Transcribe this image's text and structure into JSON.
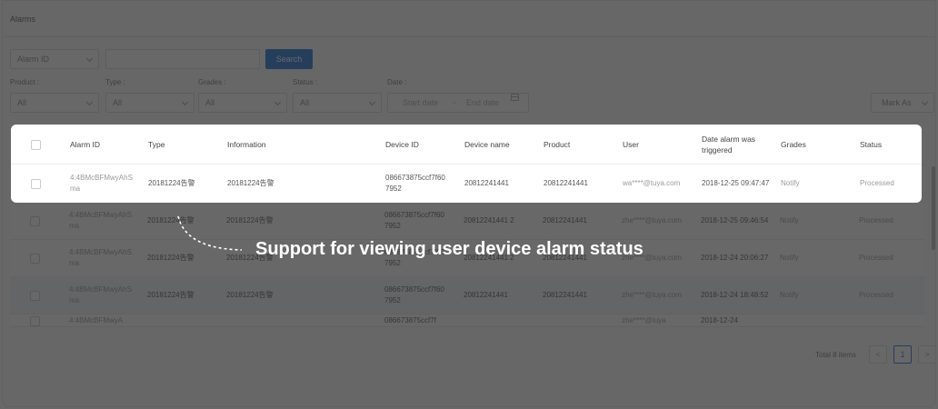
{
  "window_title": "Alarms",
  "filters": {
    "alarm_id_select": "Alarm ID",
    "search_button": "Search",
    "product_label": "Product :",
    "type_label": "Type :",
    "grades_label": "Grades :",
    "status_label": "Status :",
    "date_label": "Date :",
    "product_value": "All",
    "type_value": "All",
    "grades_value": "All",
    "status_value": "All",
    "start_date_placeholder": "Start date",
    "range_separator": "~",
    "end_date_placeholder": "End date",
    "mark_as": "Mark As"
  },
  "columns": [
    "Alarm ID",
    "Type",
    "Information",
    "Device ID",
    "Device name",
    "Product",
    "User",
    "Date alarm was triggered",
    "Grades",
    "Status"
  ],
  "rows": [
    {
      "alarm_id": "4:4BMcBFMwyAhSma",
      "type": "20181224告警",
      "information": "20181224告警",
      "device_id": "086673875ccf7f607952",
      "device_name": "20812241441",
      "product": "20812241441",
      "user": "wa****@tuya.com",
      "date": "2018-12-25 09:47:47",
      "grades": "Notify",
      "status": "Processed"
    },
    {
      "alarm_id": "4:4BMcBFMwyAhSma",
      "type": "20181224告警",
      "information": "20181224告警",
      "device_id": "086673875ccf7f607952",
      "device_name": "20812241441 2",
      "product": "20812241441",
      "user": "zhe****@tuya.com",
      "date": "2018-12-25 09:46:54",
      "grades": "Notify",
      "status": "Processed"
    },
    {
      "alarm_id": "4:4BMcBFMwyAhSma",
      "type": "20181224告警",
      "information": "20181224告警",
      "device_id": "086673875ccf7f607952",
      "device_name": "20812241441 2",
      "product": "20812241441",
      "user": "zhe****@tuya.com",
      "date": "2018-12-24 20:06:27",
      "grades": "Notify",
      "status": "Processed"
    },
    {
      "alarm_id": "4:4BMcBFMwyAhSma",
      "type": "20181224告警",
      "information": "20181224告警",
      "device_id": "086673875ccf7f607952",
      "device_name": "20812241441",
      "product": "20812241441",
      "user": "zhe****@tuya.com",
      "date": "2018-12-24 18:48:52",
      "grades": "Notify",
      "status": "Processed"
    },
    {
      "alarm_id": "4:4BMcBFMwyA",
      "type": "",
      "information": "",
      "device_id": "086673875ccf7f",
      "device_name": "",
      "product": "",
      "user": "zhe****@tuya",
      "date": "2018-12-24",
      "grades": "",
      "status": ""
    }
  ],
  "pagination": {
    "total": "Total 8 items",
    "prev": "<",
    "current": "1",
    "next": ">"
  },
  "annotation": "Support for viewing user device alarm status"
}
